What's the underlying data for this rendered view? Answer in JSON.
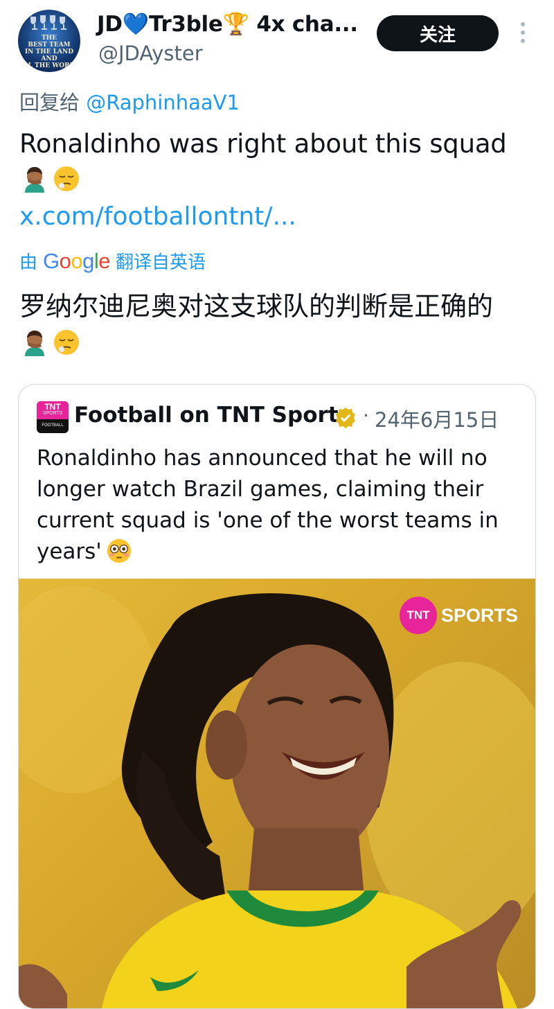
{
  "tweet": {
    "author": {
      "display_name": "JD💙Tr3ble🏆 4x cha...",
      "handle": "@JDAyster",
      "avatar_text": "THE\nBEST TEAM\nIN THE LAND AND\nALL THE WORLD"
    },
    "follow_label": "关注",
    "reply_prefix": "回复给",
    "reply_mention": "@RaphinhaaV1",
    "text": "Ronaldinho was right about this squad",
    "emojis": [
      "man-facepalming-icon",
      "relieved-sleepy-face-icon"
    ],
    "link": "x.com/footballontnt/...",
    "translate": {
      "prefix": "由",
      "brand": "Google",
      "suffix": "翻译自英语"
    },
    "translated_text": "罗纳尔迪尼奥对这支球队的判断是正确的"
  },
  "quote": {
    "logo": {
      "line1": "TNT",
      "line2": "SPORTS",
      "line3": "FOOTBALL"
    },
    "name": "Football on TNT Sports",
    "separator": "·",
    "date": "24年6月15日",
    "text": "Ronaldinho has announced that he will no longer watch Brazil games, claiming their current squad is 'one of the worst teams in years'",
    "text_emoji": "flushed-face-icon",
    "image": {
      "watermark_badge": "TNT",
      "watermark_word": "SPORTS"
    }
  },
  "colors": {
    "link_blue": "#1d9bf0",
    "secondary_gray": "#536471",
    "tnt_pink": "#e8249a",
    "verified_gold": "#e2b719"
  }
}
